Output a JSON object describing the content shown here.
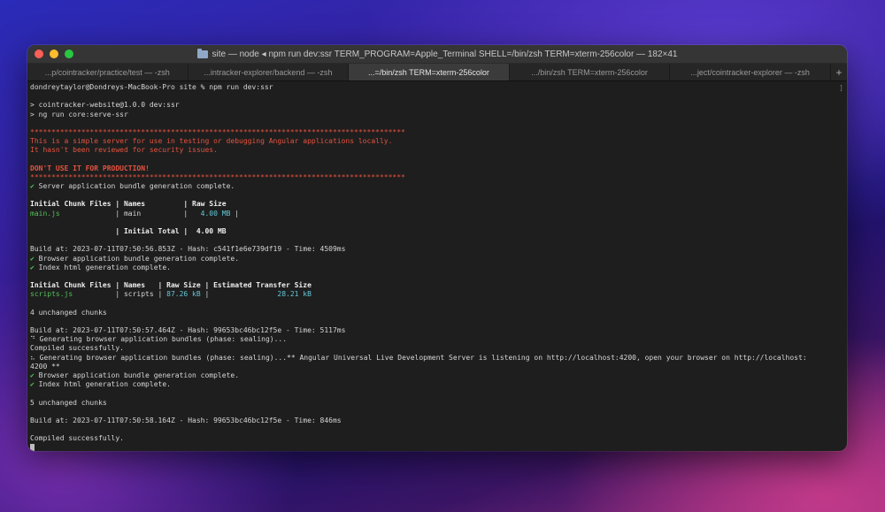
{
  "window": {
    "title": "site — node ◂ npm run dev:ssr TERM_PROGRAM=Apple_Terminal SHELL=/bin/zsh TERM=xterm-256color — 182×41",
    "tabs": [
      {
        "label": "...p/cointracker/practice/test — -zsh",
        "active": false
      },
      {
        "label": "...intracker-explorer/backend — -zsh",
        "active": false
      },
      {
        "label": "...=/bin/zsh TERM=xterm-256color",
        "active": true
      },
      {
        "label": ".../bin/zsh TERM=xterm-256color",
        "active": false
      },
      {
        "label": "...ject/cointracker-explorer — -zsh",
        "active": false
      }
    ],
    "add_tab_label": "+"
  },
  "terminal": {
    "prompt": "dondreytaylor@Dondreys-MacBook-Pro site % npm run dev:ssr",
    "run1": "> cointracker-website@1.0.0 dev:ssr",
    "run2": "> ng run core:serve-ssr",
    "stars": "****************************************************************************************",
    "warn1": "This is a simple server for use in testing or debugging Angular applications locally.",
    "warn2": "It hasn't been reviewed for security issues.",
    "warn3": "DON'T USE IT FOR PRODUCTION!",
    "server_bundle": "✔ Server application bundle generation complete.",
    "table1_header": "Initial Chunk Files | Names         | Raw Size",
    "table1_row_file": "main.js",
    "table1_row_mid": "             | main          | ",
    "table1_row_size": "  4.00 MB",
    "table1_row_end": " |",
    "table1_total_pre": "                    | ",
    "table1_total_label": "Initial Total",
    "table1_total_mid": " |  ",
    "table1_total_value": "4.00 MB",
    "build1": "Build at: 2023-07-11T07:50:56.853Z - Hash: c541f1e6e739df19 - Time: 4509ms",
    "browser_bundle1": "✔ Browser application bundle generation complete.",
    "index_html1": "✔ Index html generation complete.",
    "table2_header": "Initial Chunk Files | Names   | Raw Size | Estimated Transfer Size",
    "table2_row_file": "scripts.js",
    "table2_row_mid1": "          | scripts | ",
    "table2_row_raw": "87.26 kB",
    "table2_row_mid2": " |                ",
    "table2_row_est": "28.21 kB",
    "unchanged1": "4 unchanged chunks",
    "build2": "Build at: 2023-07-11T07:50:57.464Z - Hash: 99653bc46bc12f5e - Time: 5117ms",
    "gen1": "⠙ Generating browser application bundles (phase: sealing)...",
    "compiled1": "Compiled successfully.",
    "gen2": "⠦ Generating browser application bundles (phase: sealing)...** Angular Universal Live Development Server is listening on http://localhost:4200, open your browser on http://localhost:",
    "gen2_cont": "4200 **",
    "browser_bundle2": "✔ Browser application bundle generation complete.",
    "index_html2": "✔ Index html generation complete.",
    "unchanged2": "5 unchanged chunks",
    "build3": "Build at: 2023-07-11T07:50:58.164Z - Hash: 99653bc46bc12f5e - Time: 846ms",
    "compiled2": "Compiled successfully.",
    "scroll_mark": "]"
  },
  "colors": {
    "error_red": "#e4533f",
    "success_green": "#52c15a",
    "size_cyan": "#62c8d8",
    "terminal_bg": "#1e1e1e"
  }
}
